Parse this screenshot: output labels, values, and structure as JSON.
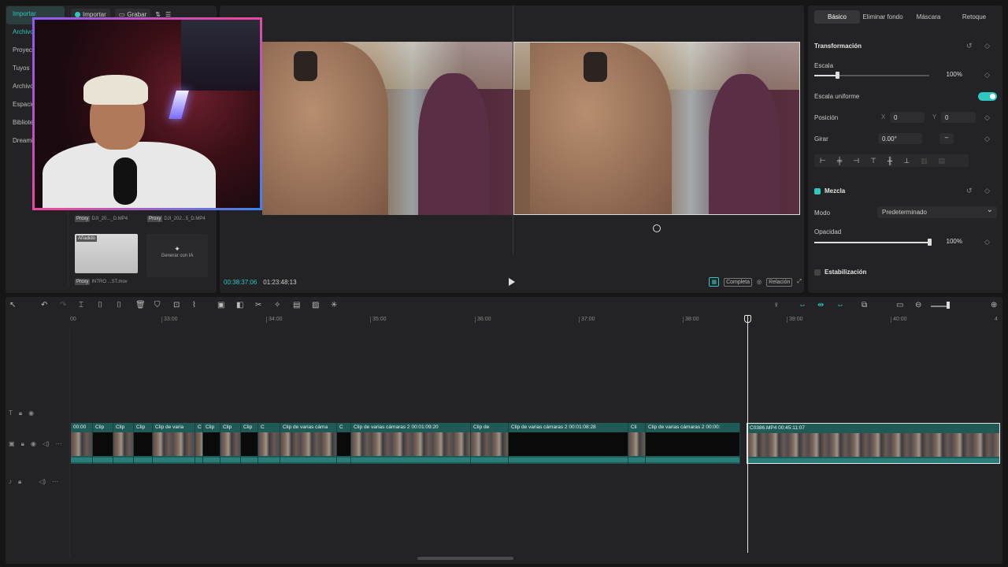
{
  "left_nav": {
    "items": [
      "Importar",
      "Archivos",
      "Proyectos",
      "Tuyos",
      "Archivos",
      "Espacio",
      "Biblioteca",
      "Dreamina"
    ],
    "toolbar": {
      "import": "Importar",
      "record": "Grabar",
      "sort_icon": "sort-icon",
      "filter_icon": "filter-icon"
    }
  },
  "media": {
    "cards": [
      {
        "tag": "Proxy",
        "name": "DJI_20..._D.MP4"
      },
      {
        "tag": "Proxy",
        "name": "DJI_202...5_D.MP4"
      },
      {
        "tag": "Proxy",
        "name": "INTRO ...ST.mov",
        "badge": "Añadido"
      }
    ],
    "generate_ai": "Generar con IA"
  },
  "player": {
    "current_time": "00:38:37:06",
    "total_time": "01:23:48:13",
    "full_label": "Completa",
    "ratio_label": "Relación"
  },
  "inspector": {
    "tabs": [
      "Básico",
      "Eliminar fondo",
      "Máscara",
      "Retoque"
    ],
    "transform_title": "Transformación",
    "scale_label": "Escala",
    "scale_value": "100%",
    "scale_fraction": 0.2,
    "uniform_label": "Escala uniforme",
    "uniform_on": true,
    "position_label": "Posición",
    "pos_x_label": "X",
    "pos_x": "0",
    "pos_y_label": "Y",
    "pos_y": "0",
    "rotate_label": "Girar",
    "rotate_value": "0.00°",
    "blend_title": "Mezcla",
    "mode_label": "Modo",
    "mode_value": "Predeterminado",
    "opacity_label": "Opacidad",
    "opacity_value": "100%",
    "opacity_fraction": 1.0,
    "stabilization_label": "Estabilización"
  },
  "timeline": {
    "ruler": [
      "00",
      "33:00",
      "34:00",
      "35:00",
      "36:00",
      "37:00",
      "38:00",
      "39:00",
      "40:00",
      "4"
    ],
    "clips": [
      {
        "label": "00:00",
        "black": false
      },
      {
        "label": "Clip",
        "black": true
      },
      {
        "label": "Clip",
        "black": false
      },
      {
        "label": "Clip",
        "black": true
      },
      {
        "label": "Clip de varia",
        "black": false
      },
      {
        "label": "C",
        "black": false
      },
      {
        "label": "Clip",
        "black": true
      },
      {
        "label": "Clip",
        "black": false
      },
      {
        "label": "Clip",
        "black": true
      },
      {
        "label": "C",
        "black": false
      },
      {
        "label": "Clip de varias cáma",
        "black": false
      },
      {
        "label": "C",
        "black": true
      },
      {
        "label": "Clip de varias cámaras 2   00:01:09:20",
        "black": false
      },
      {
        "label": "Clip de",
        "black": false
      },
      {
        "label": "Clip de varias cámaras 2   00:01:08:28",
        "black": true
      },
      {
        "label": "Cli",
        "black": false
      },
      {
        "label": "Clip de varias cámaras 2   00:00:",
        "black": true
      },
      {
        "label": "C0386.MP4   00:45:11:07",
        "black": false
      }
    ]
  },
  "colors": {
    "accent": "#2fc7c0",
    "clip": "#1f5a57"
  }
}
